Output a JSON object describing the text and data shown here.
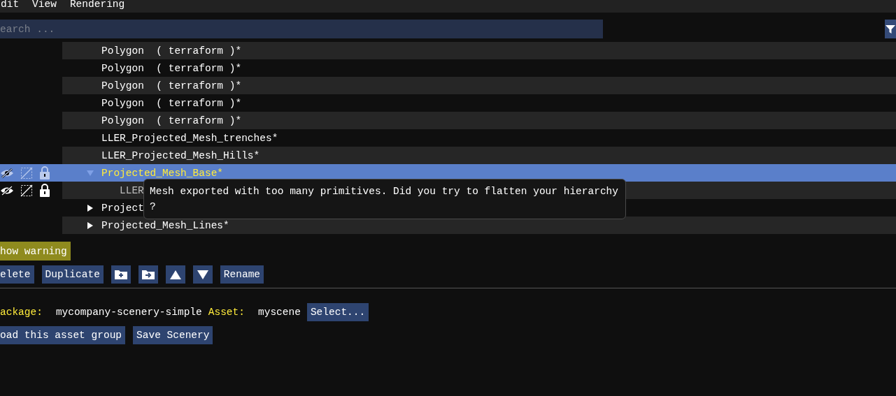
{
  "menu": [
    "dit",
    "View",
    "Rendering"
  ],
  "search": {
    "placeholder": "earch ..."
  },
  "tree": [
    {
      "label": "Polygon  ( terraform )*",
      "selected": false,
      "flags": false
    },
    {
      "label": "Polygon  ( terraform )*",
      "selected": false,
      "flags": false
    },
    {
      "label": "Polygon  ( terraform )*",
      "selected": false,
      "flags": false
    },
    {
      "label": "Polygon  ( terraform )*",
      "selected": false,
      "flags": false
    },
    {
      "label": "Polygon  ( terraform )*",
      "selected": false,
      "flags": false
    },
    {
      "label": "LLER_Projected_Mesh_trenches*",
      "selected": false,
      "flags": false
    },
    {
      "label": "LLER_Projected_Mesh_Hills*",
      "selected": false,
      "flags": false
    },
    {
      "label": "Projected_Mesh_Base*",
      "selected": true,
      "flags": true,
      "expanded": true,
      "children": [
        {
          "label": "LLER",
          "selected": false,
          "flags": true
        }
      ]
    },
    {
      "label": "Project",
      "selected": false,
      "flags": false,
      "expanded": false
    },
    {
      "label": "Projected_Mesh_Lines*",
      "selected": false,
      "flags": false,
      "expanded": false
    }
  ],
  "tooltip": "Mesh exported with too many primitives. Did you try to flatten your hierarchy ?",
  "warning_button": "how warning",
  "toolbar": [
    {
      "kind": "text",
      "label": "elete"
    },
    {
      "kind": "text",
      "label": "Duplicate"
    },
    {
      "kind": "folder-plus"
    },
    {
      "kind": "folder-arrow"
    },
    {
      "kind": "up"
    },
    {
      "kind": "down"
    },
    {
      "kind": "text",
      "label": "Rename"
    }
  ],
  "package": {
    "label": "ackage:",
    "value": "mycompany-scenery-simple",
    "asset_label": "Asset:",
    "asset_value": "myscene",
    "select_button": "Select..."
  },
  "actions": [
    "oad this asset group",
    "Save Scenery"
  ]
}
